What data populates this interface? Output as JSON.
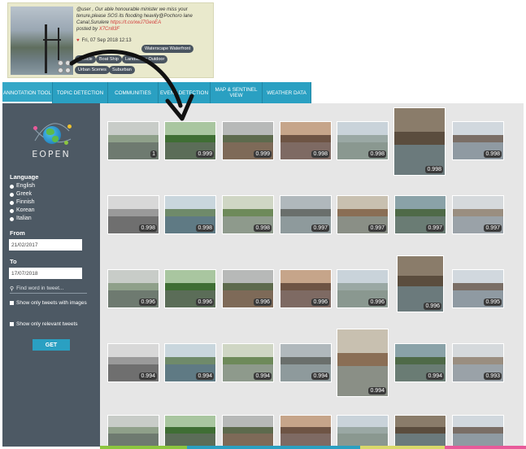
{
  "tweet": {
    "text_prefix": "@user , Our able honourable minister we miss your tenure,please SOS its flooding heavily@Pochoro lane Canal,Surulere ",
    "link": "https://t.co/xwJ7GeoEA",
    "posted_by_label": "posted by ",
    "posted_by_user": "X7Cn83F",
    "date": "Fri, 07 Sep 2018 12:13",
    "tags": [
      "Waterscape Waterfront",
      "Vehicle",
      "Boat Ship",
      "Landscape Outdoor",
      "Urban Scenes",
      "Suburban"
    ]
  },
  "nav": {
    "tabs": [
      {
        "label": "ANNOTATION TOOL"
      },
      {
        "label": "TOPIC DETECTION"
      },
      {
        "label": "COMMUNITIES"
      },
      {
        "label": "EVENT DETECTION"
      },
      {
        "label": "MAP & SENTINEL VIEW"
      },
      {
        "label": "WEATHER DATA"
      }
    ]
  },
  "sidebar": {
    "logo_text": "EOPEN",
    "language_label": "Language",
    "languages": [
      "English",
      "Greek",
      "Finnish",
      "Korean",
      "Italian"
    ],
    "selected_language": "English",
    "from_label": "From",
    "from_value": "21/02/2017",
    "to_label": "To",
    "to_value": "17/07/2018",
    "search_placeholder": "Find word in tweet...",
    "only_images_label": "Show only tweets with images",
    "only_relevant_label": "Show only relevant tweets",
    "get_label": "GET"
  },
  "scores": [
    [
      "1",
      "0.999",
      "0.999",
      "0.998",
      "0.998",
      "0.998",
      "0.998"
    ],
    [
      "0.998",
      "0.998",
      "0.998",
      "0.997",
      "0.997",
      "0.997",
      "0.997"
    ],
    [
      "0.996",
      "0.996",
      "0.996",
      "0.996",
      "0.996",
      "0.996",
      "0.995"
    ],
    [
      "0.994",
      "0.994",
      "0.994",
      "0.994",
      "0.994",
      "0.994",
      "0.993"
    ],
    [
      "",
      "",
      "",
      "",
      "",
      "",
      ""
    ]
  ],
  "colors": {
    "accent": "#2aa0c2",
    "sidebar": "#4d5964",
    "grid_bg": "#e6e6e6",
    "badge": "#3a3a3a",
    "tweet_bg": "#e9e9cc"
  }
}
